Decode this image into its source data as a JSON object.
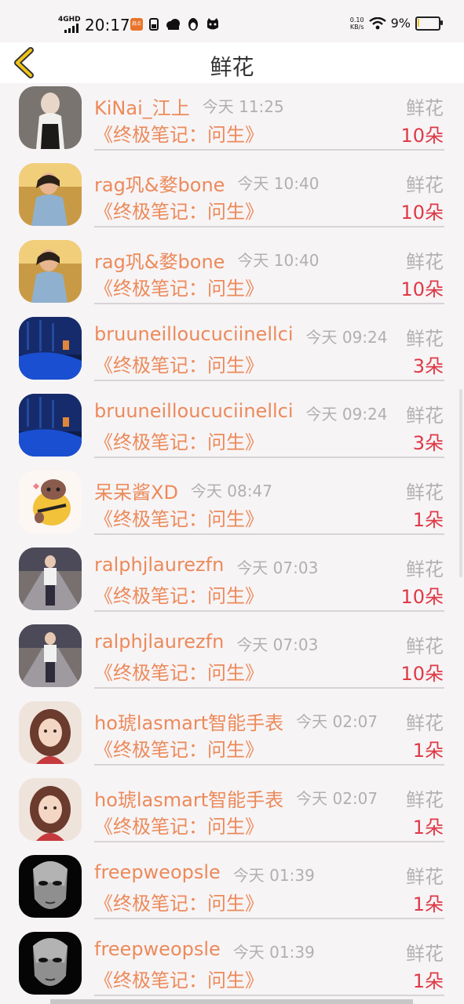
{
  "status_bar": {
    "network": "4GHD",
    "time": "20:17",
    "app_badge": "肩点",
    "speed_value": "0.10",
    "speed_unit": "KB/s",
    "battery": "9%",
    "battery_level": 0.09
  },
  "header": {
    "title": "鲜花",
    "back_icon": "chevron-left-icon",
    "accent": "#f0c419"
  },
  "colors": {
    "name": "#ec8a5a",
    "time": "#b0b0b0",
    "gift_type": "#b2b2b2",
    "quantity": "#de3a46"
  },
  "items": [
    {
      "name": "KiNai_江上",
      "time": "今天 11:25",
      "gift": "鲜花",
      "book": "《终极笔记：问生》",
      "quantity": "10朵",
      "avatar": "portrait"
    },
    {
      "name": "rag巩&婺bone",
      "time": "今天 10:40",
      "gift": "鲜花",
      "book": "《终极笔记：问生》",
      "quantity": "10朵",
      "avatar": "field-boy"
    },
    {
      "name": "rag巩&婺bone",
      "time": "今天 10:40",
      "gift": "鲜花",
      "book": "《终极笔记：问生》",
      "quantity": "10朵",
      "avatar": "field-boy"
    },
    {
      "name": "bruuneilloucuciinellci",
      "time": "今天 09:24",
      "gift": "鲜花",
      "book": "《终极笔记：问生》",
      "quantity": "3朵",
      "avatar": "night-scene"
    },
    {
      "name": "bruuneilloucuciinellci",
      "time": "今天 09:24",
      "gift": "鲜花",
      "book": "《终极笔记：问生》",
      "quantity": "3朵",
      "avatar": "night-scene"
    },
    {
      "name": "呆呆酱XD",
      "time": "今天 08:47",
      "gift": "鲜花",
      "book": "《终极笔记：问生》",
      "quantity": "1朵",
      "avatar": "cartoon-mole"
    },
    {
      "name": "ralphjlaurezfn",
      "time": "今天 07:03",
      "gift": "鲜花",
      "book": "《终极笔记：问生》",
      "quantity": "10朵",
      "avatar": "road-person"
    },
    {
      "name": "ralphjlaurezfn",
      "time": "今天 07:03",
      "gift": "鲜花",
      "book": "《终极笔记：问生》",
      "quantity": "10朵",
      "avatar": "road-person"
    },
    {
      "name": "ho琥lasmart智能手表",
      "time": "今天 02:07",
      "gift": "鲜花",
      "book": "《终极笔记：问生》",
      "quantity": "1朵",
      "avatar": "girl"
    },
    {
      "name": "ho琥lasmart智能手表",
      "time": "今天 02:07",
      "gift": "鲜花",
      "book": "《终极笔记：问生》",
      "quantity": "1朵",
      "avatar": "girl"
    },
    {
      "name": "freepweopsle",
      "time": "今天 01:39",
      "gift": "鲜花",
      "book": "《终极笔记：问生》",
      "quantity": "1朵",
      "avatar": "mask"
    },
    {
      "name": "freepweopsle",
      "time": "今天 01:39",
      "gift": "鲜花",
      "book": "《终极笔记：问生》",
      "quantity": "1朵",
      "avatar": "mask"
    }
  ]
}
